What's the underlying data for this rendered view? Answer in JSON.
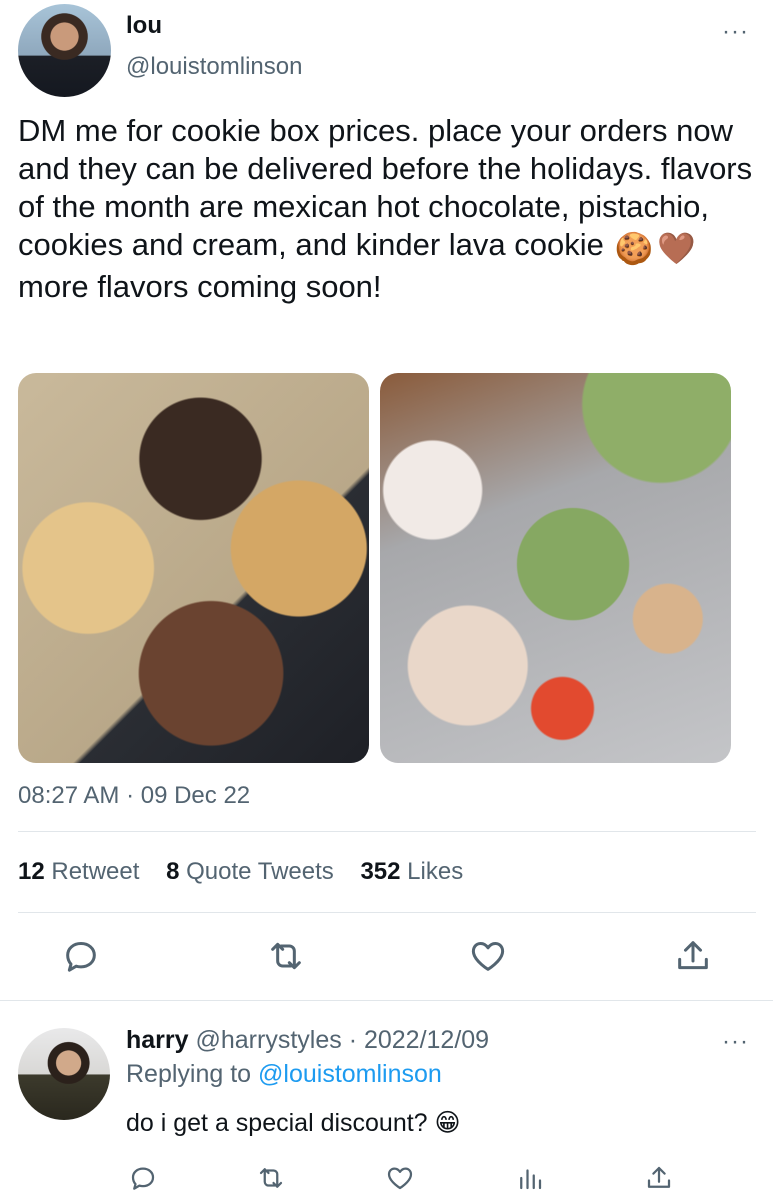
{
  "tweet": {
    "author_name": "lou",
    "author_handle": "@louistomlinson",
    "text_main": "DM me for cookie box prices. place your orders now and they can be delivered before the holidays. flavors of the month are mexican hot chocolate, pistachio, cookies and cream, and kinder lava cookie",
    "emoji_1": "🍪",
    "emoji_2": "🤎",
    "text_tail": "more flavors coming soon!",
    "timestamp": "08:27 AM · 09 Dec 22",
    "stats": {
      "retweets_count": "12",
      "retweets_label": "Retweet",
      "quotes_count": "8",
      "quotes_label": "Quote Tweets",
      "likes_count": "352",
      "likes_label": "Likes"
    },
    "more_label": "···"
  },
  "reply": {
    "author_name": "harry",
    "author_handle": "@harrystyles",
    "date": "2022/12/09",
    "replying_to_label": "Replying to",
    "replying_to_handle": "@louistomlinson",
    "text": "do i get a special discount?",
    "emoji": "😁",
    "more_label": "···"
  },
  "icons": {
    "reply": "comment-icon",
    "retweet": "retweet-icon",
    "like": "heart-icon",
    "share": "share-icon",
    "views": "analytics-icon"
  }
}
